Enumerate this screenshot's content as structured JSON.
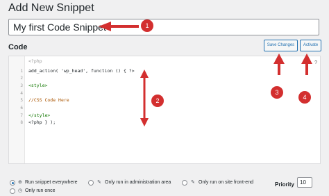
{
  "header": {
    "title": "Add New Snippet"
  },
  "title_field": {
    "value": "My first Code Snippet"
  },
  "code_section": {
    "label": "Code",
    "save_label": "Save Changes",
    "activate_label": "Activate",
    "hint": "?"
  },
  "editor": {
    "line_numbers": [
      "1",
      "2",
      "3",
      "4",
      "5",
      "6",
      "7",
      "8"
    ],
    "header_comment": "<?php",
    "lines": [
      "add_action( 'wp_head', function () { ?>",
      "",
      "<style>",
      "",
      "//CSS Code Here",
      "",
      "</style>",
      "<?php } );"
    ]
  },
  "scope": {
    "options": [
      {
        "label": "Run snippet everywhere",
        "icon": "globe-icon",
        "checked": true
      },
      {
        "label": "Only run in administration area",
        "icon": "wrench-icon",
        "checked": false
      },
      {
        "label": "Only run on site front-end",
        "icon": "wrench-icon",
        "checked": false
      },
      {
        "label": "Only run once",
        "icon": "clock-icon",
        "checked": false
      }
    ]
  },
  "priority": {
    "label": "Priority",
    "value": "10"
  },
  "annotations": {
    "markers": [
      "1",
      "2",
      "3",
      "4"
    ],
    "color": "#d32f2f"
  }
}
